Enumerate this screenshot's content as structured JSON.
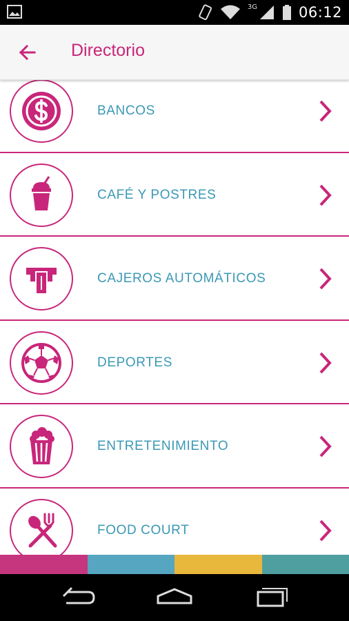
{
  "status_bar": {
    "time": "06:12",
    "network": "3G"
  },
  "app_bar": {
    "title": "Directorio",
    "back_icon": "arrow-left-icon"
  },
  "list": {
    "items": [
      {
        "label": "BANCOS",
        "icon": "dollar-icon"
      },
      {
        "label": "CAFÉ Y POSTRES",
        "icon": "drink-cup-icon"
      },
      {
        "label": "CAJEROS AUTOMÁTICOS",
        "icon": "atm-icon"
      },
      {
        "label": "DEPORTES",
        "icon": "soccer-ball-icon"
      },
      {
        "label": "ENTRETENIMIENTO",
        "icon": "popcorn-icon"
      },
      {
        "label": "FOOD COURT",
        "icon": "fork-spoon-icon"
      }
    ]
  },
  "colors": {
    "accent": "#c8267a",
    "label": "#3b98b4",
    "strip": [
      "#c6367e",
      "#56a5c1",
      "#e8b83c",
      "#4f9fa0"
    ]
  }
}
